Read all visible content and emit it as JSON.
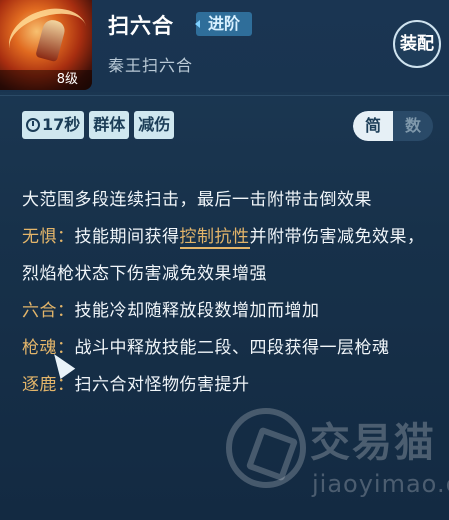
{
  "skill": {
    "name": "扫六合",
    "advance_label": "进阶",
    "subtitle": "秦王扫六合",
    "level": "8级",
    "equip_label": "装配"
  },
  "tags": [
    "17秒",
    "群体",
    "减伤"
  ],
  "view_toggle": {
    "simple": "简",
    "numeric": "数",
    "selected": "简"
  },
  "description": {
    "main": "大范围多段连续扫击，最后一击附带击倒效果",
    "effects": [
      {
        "label": "无惧：",
        "before": "技能期间获得",
        "link": "控制抗性",
        "after": "并附带伤害减免效果，烈焰枪状态下伤害减免效果增强"
      },
      {
        "label": "六合：",
        "text": "技能冷却随释放段数增加而增加"
      },
      {
        "label": "枪魂：",
        "text": "战斗中释放技能二段、四段获得一层枪魂"
      },
      {
        "label": "逐鹿：",
        "text": "扫六合对怪物伤害提升"
      }
    ]
  },
  "watermark": {
    "cn": "交易猫",
    "en": "jiaoyimao.com"
  },
  "colors": {
    "accent_gold": "#e3b56a",
    "tag_bg": "#cfe7ef",
    "panel_bg": "#17314a"
  }
}
